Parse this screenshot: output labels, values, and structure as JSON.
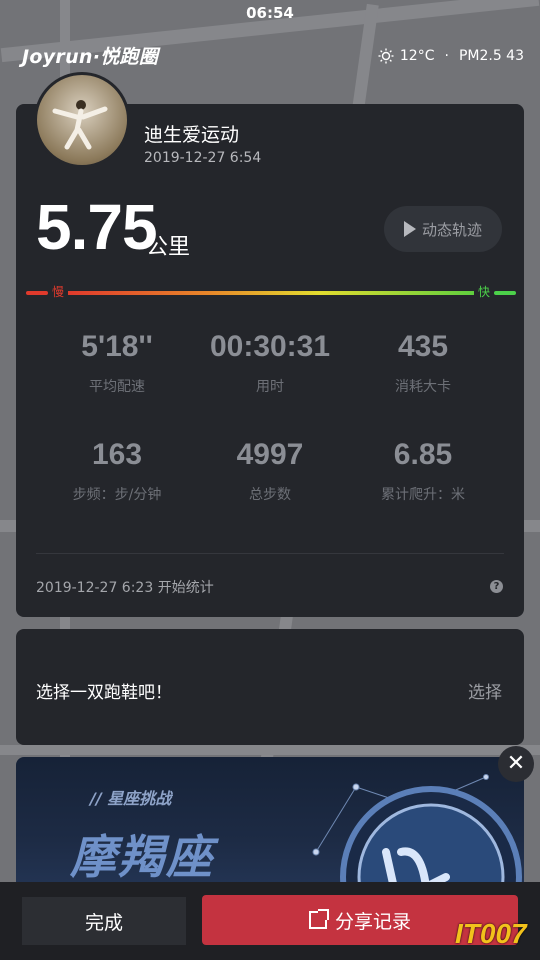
{
  "status_bar": {
    "time": "06:54"
  },
  "header": {
    "brand": "Joyrun·悦跑圈",
    "weather_icon": "sun-icon",
    "temperature": "12°C",
    "separator": "·",
    "air_quality": "PM2.5 43"
  },
  "run": {
    "user_name": "迪生爱运动",
    "date_time": "2019-12-27 6:54",
    "distance": "5.75",
    "distance_unit": "公里",
    "track_button": "动态轨迹",
    "speed_slow_label": "慢",
    "speed_fast_label": "快",
    "stats": [
      {
        "value": "5'18''",
        "label": "平均配速"
      },
      {
        "value": "00:30:31",
        "label": "用时"
      },
      {
        "value": "435",
        "label": "消耗大卡"
      },
      {
        "value": "163",
        "label": "步频：步/分钟"
      },
      {
        "value": "4997",
        "label": "总步数"
      },
      {
        "value": "6.85",
        "label": "累计爬升：米"
      }
    ],
    "start_text": "2019-12-27 6:23 开始统计",
    "help": "?"
  },
  "shoe": {
    "prompt": "选择一双跑鞋吧！",
    "action": "选择"
  },
  "banner": {
    "tag": "// 星座挑战",
    "title": "摩羯座",
    "close": "✕"
  },
  "bottom": {
    "done": "完成",
    "share": "分享记录"
  },
  "watermark": "IT007"
}
